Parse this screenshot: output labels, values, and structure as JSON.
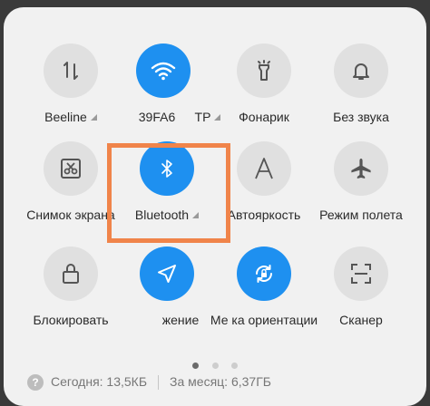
{
  "row1": [
    {
      "label": "Beeline",
      "icon": "data-transfer-icon",
      "active": false,
      "tri": true
    },
    {
      "label": "39FA6",
      "icon": "wifi-icon",
      "active": true,
      "tri": false
    },
    {
      "label": "TP",
      "icon": "hotspot-icon",
      "active": false,
      "tri": true
    },
    {
      "label": "Фонарик",
      "icon": "flashlight-icon",
      "active": false,
      "tri": false
    },
    {
      "label": "Без звука",
      "icon": "bell-icon",
      "active": false,
      "tri": false
    }
  ],
  "row2": [
    {
      "label": "Снимок экрана",
      "icon": "screenshot-icon",
      "active": false
    },
    {
      "label": "Bluetooth",
      "icon": "bluetooth-icon",
      "active": true,
      "tri": true
    },
    {
      "label": "Автояркость",
      "icon": "auto-brightness-icon",
      "active": false
    },
    {
      "label": "Режим полета",
      "icon": "airplane-icon",
      "active": false
    }
  ],
  "row3": [
    {
      "label": "Блокировать",
      "icon": "lock-icon",
      "active": false
    },
    {
      "label": "жение",
      "icon": "location-icon",
      "active": true
    },
    {
      "label": "Ме  ка ориентации",
      "icon": "rotation-lock-icon",
      "active": true
    },
    {
      "label": "Сканер",
      "icon": "scanner-icon",
      "active": false
    }
  ],
  "footer": {
    "today": "Сегодня: 13,5КБ",
    "month": "За месяц: 6,37ГБ",
    "help_icon": "?"
  },
  "colors": {
    "active": "#1e90f0",
    "inactive": "#e0e0e0",
    "highlight": "#f0844a",
    "panel": "#f1f1f1"
  }
}
